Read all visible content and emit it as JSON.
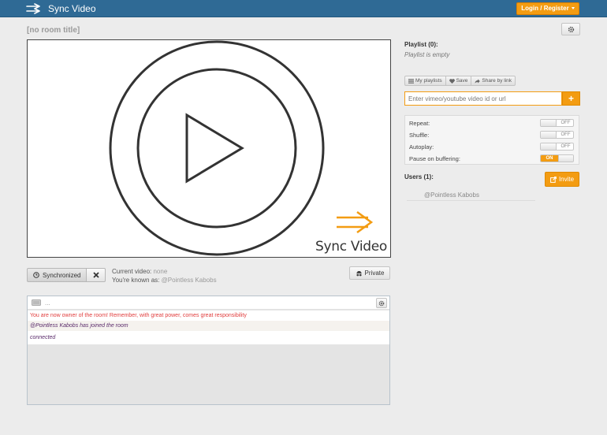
{
  "navbar": {
    "brand": "Sync Video",
    "login_label": "Login / Register"
  },
  "room": {
    "title": "[no room title]"
  },
  "player": {
    "watermark": "Sync Video"
  },
  "controls": {
    "sync_label": "Synchronized",
    "current_video_label": "Current video:",
    "current_video_value": "none",
    "known_as_label": "You're known as:",
    "known_as_value": "@Pointless Kabobs",
    "private_label": "Private"
  },
  "chat": {
    "input_placeholder": "...",
    "messages": [
      "You are now owner of the room! Remember, with great power, comes great responsibility",
      "@Pointless Kabobs has joined the room",
      "connected"
    ]
  },
  "playlist": {
    "title": "Playlist (0):",
    "empty_text": "Playlist is empty",
    "actions": [
      "My playlists",
      "Save",
      "Share by link"
    ],
    "input_placeholder": "Enter vimeo/youtube video id or url",
    "add_label": "+"
  },
  "options": [
    {
      "label": "Repeat:",
      "state": "OFF"
    },
    {
      "label": "Shuffle:",
      "state": "OFF"
    },
    {
      "label": "Autoplay:",
      "state": "OFF"
    },
    {
      "label": "Pause on buffering:",
      "state": "ON"
    }
  ],
  "users": {
    "title": "Users (1):",
    "invite_label": "Invite",
    "list": [
      "@Pointless Kabobs"
    ]
  },
  "colors": {
    "navbar": "#2f6a95",
    "accent": "#f39c12",
    "chat_alert": "#e13d3d"
  }
}
